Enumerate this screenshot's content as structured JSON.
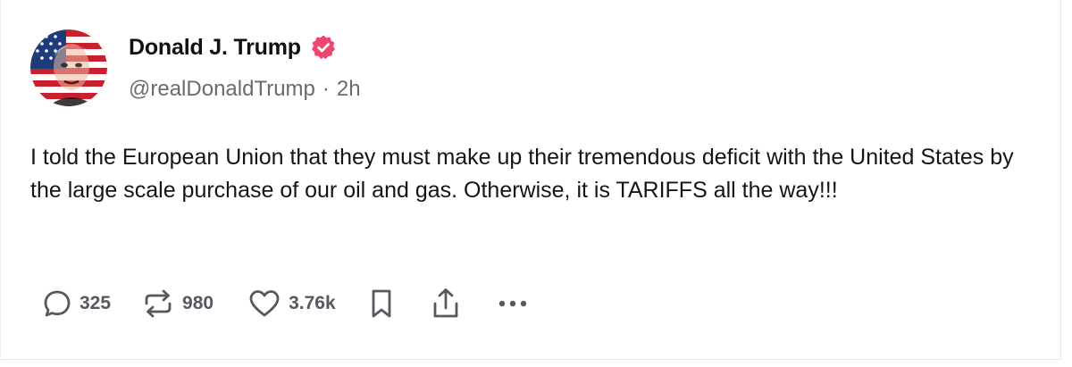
{
  "post": {
    "author": {
      "display_name": "Donald J. Trump",
      "handle": "@realDonaldTrump",
      "time_sep": "·",
      "time_ago": "2h",
      "verified_color": "#f0466e",
      "avatar_icon": "avatar-flag-portrait"
    },
    "text": "I told the European Union that they must make up their tremendous deficit with the United States by the large scale purchase of our oil and gas. Otherwise, it is TARIFFS all the way!!!",
    "actions": {
      "reply_count": "325",
      "repost_count": "980",
      "like_count": "3.76k",
      "icons": [
        "reply-icon",
        "repost-icon",
        "like-icon",
        "bookmark-icon",
        "share-icon",
        "more-icon"
      ]
    }
  },
  "colors": {
    "text": "#151515",
    "muted": "#6b6b6b",
    "icon": "#555a60"
  }
}
